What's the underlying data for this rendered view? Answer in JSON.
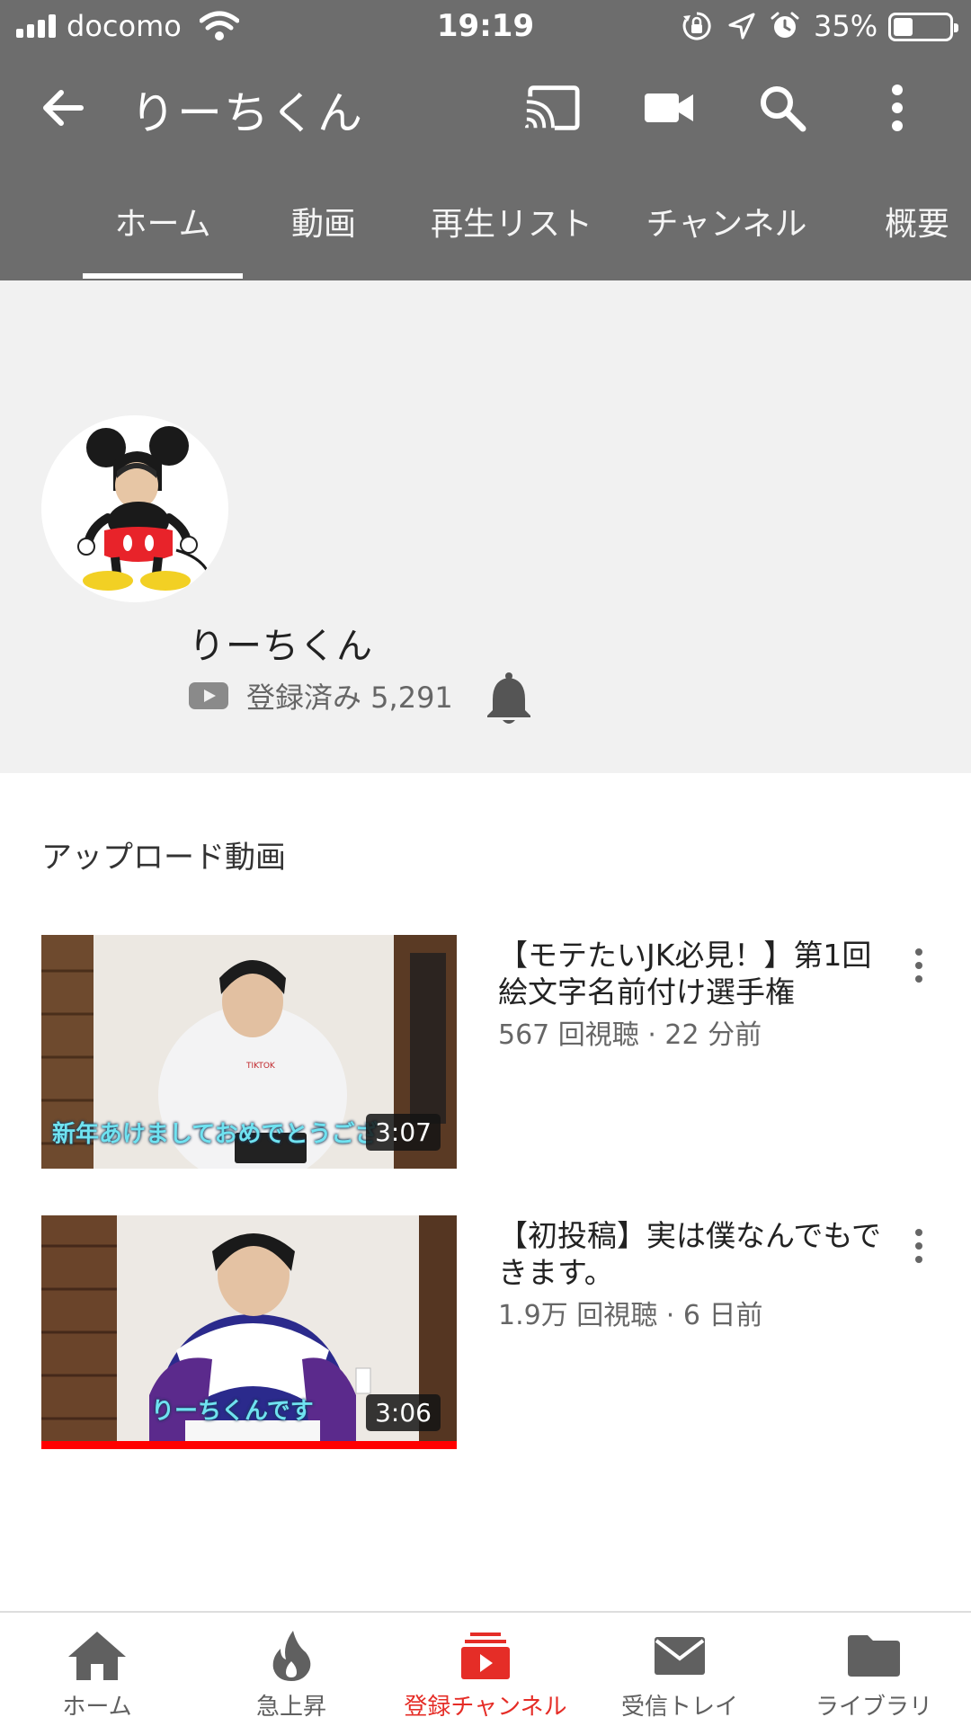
{
  "status_bar": {
    "carrier": "docomo",
    "time": "19:19",
    "battery_percent": "35%",
    "battery_level": 0.35,
    "icons": [
      "signal-icon",
      "wifi-icon",
      "orientation-lock-icon",
      "location-icon",
      "alarm-icon",
      "battery-icon"
    ]
  },
  "toolbar": {
    "title": "りーちくん",
    "icons": [
      "back-arrow-icon",
      "cast-icon",
      "video-camera-icon",
      "search-icon",
      "more-vert-icon"
    ]
  },
  "tabs": [
    {
      "label": "ホーム",
      "active": true
    },
    {
      "label": "動画",
      "active": false
    },
    {
      "label": "再生リスト",
      "active": false
    },
    {
      "label": "チャンネル",
      "active": false
    },
    {
      "label": "概要",
      "active": false
    }
  ],
  "channel": {
    "name": "りーちくん",
    "subscription_text": "登録済み 5,291"
  },
  "uploads": {
    "section_title": "アップロード動画",
    "videos": [
      {
        "title": "【モテたいJK必見！】第1回絵文字名前付け選手権",
        "meta": "567 回視聴 · 22 分前",
        "duration": "3:07",
        "caption": "新年あけましておめでとうござ",
        "watched_fraction": 0
      },
      {
        "title": "【初投稿】実は僕なんでもできます。",
        "meta": "1.9万 回視聴 · 6 日前",
        "duration": "3:06",
        "caption": "りーちくんです",
        "watched_fraction": 1.0
      }
    ]
  },
  "bottom_nav": [
    {
      "label": "ホーム",
      "icon": "home-icon",
      "active": false
    },
    {
      "label": "急上昇",
      "icon": "fire-icon",
      "active": false
    },
    {
      "label": "登録チャンネル",
      "icon": "subscriptions-icon",
      "active": true
    },
    {
      "label": "受信トレイ",
      "icon": "mail-icon",
      "active": false
    },
    {
      "label": "ライブラリ",
      "icon": "folder-icon",
      "active": false
    }
  ],
  "colors": {
    "header_bg": "#6d6d6d",
    "banner_bg": "#f1f1f1",
    "accent_red": "#e52d27",
    "progress_red": "#ff0000"
  }
}
